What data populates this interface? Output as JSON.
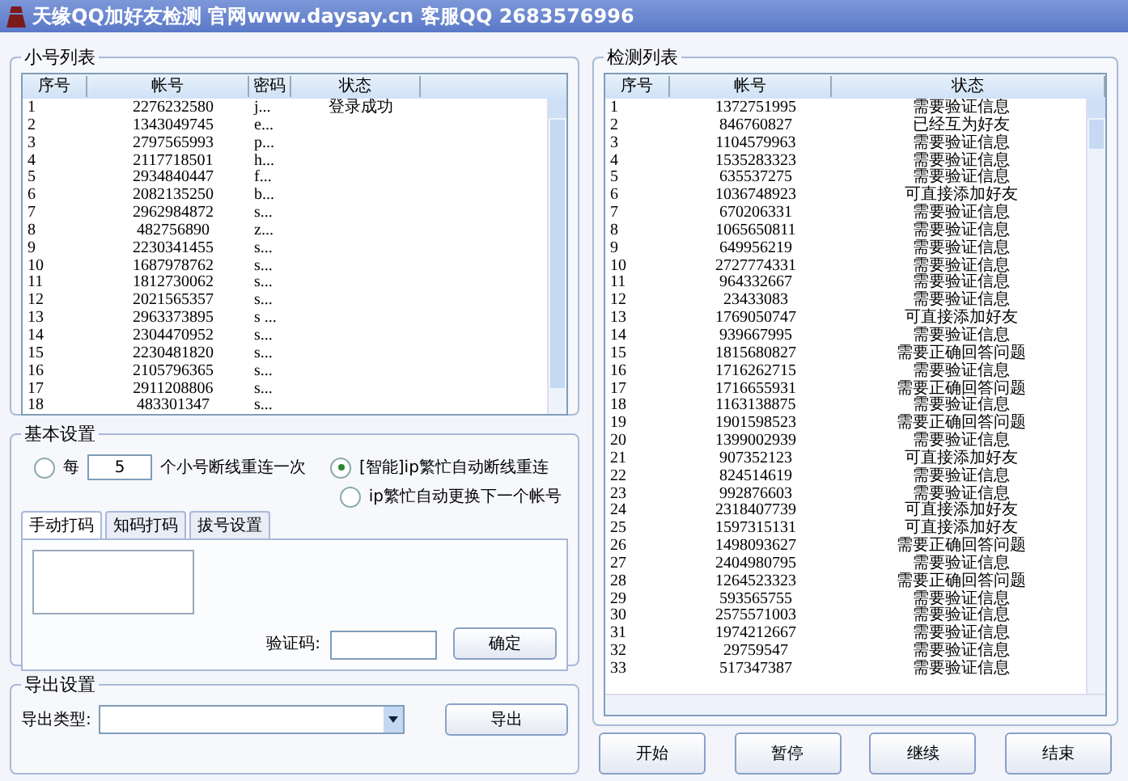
{
  "window": {
    "title": "天缘QQ加好友检测 官网www.daysay.cn 客服QQ 2683576996"
  },
  "accounts": {
    "title": "小号列表",
    "columns": [
      "序号",
      "帐号",
      "密码",
      "状态"
    ],
    "rows": [
      {
        "index": "1",
        "account": "2276232580",
        "password": "j...",
        "status": "登录成功"
      },
      {
        "index": "2",
        "account": "1343049745",
        "password": "e..."
      },
      {
        "index": "3",
        "account": "2797565993",
        "password": "p..."
      },
      {
        "index": "4",
        "account": "2117718501",
        "password": "h..."
      },
      {
        "index": "5",
        "account": "2934840447",
        "password": "f..."
      },
      {
        "index": "6",
        "account": "2082135250",
        "password": "b..."
      },
      {
        "index": "7",
        "account": "2962984872",
        "password": "s..."
      },
      {
        "index": "8",
        "account": "482756890",
        "password": "z..."
      },
      {
        "index": "9",
        "account": "2230341455",
        "password": "s..."
      },
      {
        "index": "10",
        "account": "1687978762",
        "password": "s..."
      },
      {
        "index": "11",
        "account": "1812730062",
        "password": "s..."
      },
      {
        "index": "12",
        "account": "2021565357",
        "password": "s..."
      },
      {
        "index": "13",
        "account": "2963373895",
        "password": "s ..."
      },
      {
        "index": "14",
        "account": "2304470952",
        "password": "s..."
      },
      {
        "index": "15",
        "account": "2230481820",
        "password": "s..."
      },
      {
        "index": "16",
        "account": "2105796365",
        "password": "s..."
      },
      {
        "index": "17",
        "account": "2911208806",
        "password": "s..."
      },
      {
        "index": "18",
        "account": "483301347",
        "password": "s..."
      }
    ]
  },
  "settings": {
    "title": "基本设置",
    "reconnect_every": {
      "prefix": "每",
      "value": "5",
      "suffix": "个小号断线重连一次",
      "selected": false
    },
    "options": [
      {
        "label": "[智能]ip繁忙自动断线重连",
        "selected": true
      },
      {
        "label": "ip繁忙自动更换下一个帐号",
        "selected": false
      }
    ],
    "tabs": [
      {
        "label": "手动打码",
        "selected": true
      },
      {
        "label": "知码打码",
        "selected": false
      },
      {
        "label": "拔号设置",
        "selected": false
      }
    ],
    "captcha_label": "验证码:",
    "confirm_button": "确定"
  },
  "export": {
    "title": "导出设置",
    "type_label": "导出类型:",
    "button": "导出"
  },
  "detection": {
    "title": "检测列表",
    "columns": [
      "序号",
      "帐号",
      "状态"
    ],
    "rows": [
      {
        "index": "1",
        "account": "1372751995",
        "status": "需要验证信息"
      },
      {
        "index": "2",
        "account": "846760827",
        "status": "已经互为好友"
      },
      {
        "index": "3",
        "account": "1104579963",
        "status": "需要验证信息"
      },
      {
        "index": "4",
        "account": "1535283323",
        "status": "需要验证信息"
      },
      {
        "index": "5",
        "account": "635537275",
        "status": "需要验证信息"
      },
      {
        "index": "6",
        "account": "1036748923",
        "status": "可直接添加好友"
      },
      {
        "index": "7",
        "account": "670206331",
        "status": "需要验证信息"
      },
      {
        "index": "8",
        "account": "1065650811",
        "status": "需要验证信息"
      },
      {
        "index": "9",
        "account": "649956219",
        "status": "需要验证信息"
      },
      {
        "index": "10",
        "account": "2727774331",
        "status": "需要验证信息"
      },
      {
        "index": "11",
        "account": "964332667",
        "status": "需要验证信息"
      },
      {
        "index": "12",
        "account": "23433083",
        "status": "需要验证信息"
      },
      {
        "index": "13",
        "account": "1769050747",
        "status": "可直接添加好友"
      },
      {
        "index": "14",
        "account": "939667995",
        "status": "需要验证信息"
      },
      {
        "index": "15",
        "account": "1815680827",
        "status": "需要正确回答问题"
      },
      {
        "index": "16",
        "account": "1716262715",
        "status": "需要验证信息"
      },
      {
        "index": "17",
        "account": "1716655931",
        "status": "需要正确回答问题"
      },
      {
        "index": "18",
        "account": "1163138875",
        "status": "需要验证信息"
      },
      {
        "index": "19",
        "account": "1901598523",
        "status": "需要正确回答问题"
      },
      {
        "index": "20",
        "account": "1399002939",
        "status": "需要验证信息"
      },
      {
        "index": "21",
        "account": "907352123",
        "status": "可直接添加好友"
      },
      {
        "index": "22",
        "account": "824514619",
        "status": "需要验证信息"
      },
      {
        "index": "23",
        "account": "992876603",
        "status": "需要验证信息"
      },
      {
        "index": "24",
        "account": "2318407739",
        "status": "可直接添加好友"
      },
      {
        "index": "25",
        "account": "1597315131",
        "status": "可直接添加好友"
      },
      {
        "index": "26",
        "account": "1498093627",
        "status": "需要正确回答问题"
      },
      {
        "index": "27",
        "account": "2404980795",
        "status": "需要验证信息"
      },
      {
        "index": "28",
        "account": "1264523323",
        "status": "需要正确回答问题"
      },
      {
        "index": "29",
        "account": "593565755",
        "status": "需要验证信息"
      },
      {
        "index": "30",
        "account": "2575571003",
        "status": "需要验证信息"
      },
      {
        "index": "31",
        "account": "1974212667",
        "status": "需要验证信息"
      },
      {
        "index": "32",
        "account": "29759547",
        "status": "需要验证信息"
      },
      {
        "index": "33",
        "account": "517347387",
        "status": "需要验证信息"
      }
    ]
  },
  "buttons": [
    "开始",
    "暂停",
    "继续",
    "结束"
  ]
}
